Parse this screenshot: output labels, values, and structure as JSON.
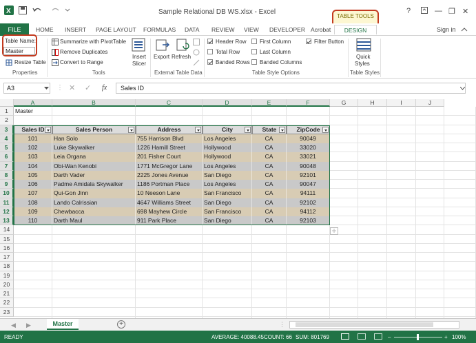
{
  "window": {
    "title": "Sample Relational DB WS.xlsx - Excel",
    "context_group": "TABLE TOOLS",
    "sign_in": "Sign in",
    "help": "?",
    "minimize": "—",
    "restore": "❐",
    "close": "✕"
  },
  "tabs": {
    "file": "FILE",
    "items": [
      "HOME",
      "INSERT",
      "PAGE LAYOUT",
      "FORMULAS",
      "DATA",
      "REVIEW",
      "VIEW",
      "DEVELOPER",
      "Acrobat"
    ],
    "design": "DESIGN"
  },
  "ribbon": {
    "properties": {
      "table_name_label": "Table Name:",
      "table_name_value": "Master",
      "resize": "Resize Table",
      "group": "Properties"
    },
    "tools": {
      "summarize": "Summarize with PivotTable",
      "remove_dup": "Remove Duplicates",
      "convert": "Convert to Range",
      "slicer1": "Insert",
      "slicer2": "Slicer",
      "group": "Tools"
    },
    "external": {
      "export": "Export",
      "refresh": "Refresh",
      "group": "External Table Data"
    },
    "style_options": {
      "header_row": "Header Row",
      "total_row": "Total Row",
      "banded_rows": "Banded Rows",
      "first_col": "First Column",
      "last_col": "Last Column",
      "banded_cols": "Banded Columns",
      "filter_btn": "Filter Button",
      "group": "Table Style Options"
    },
    "styles": {
      "quick1": "Quick",
      "quick2": "Styles",
      "group": "Table Styles"
    }
  },
  "formula_bar": {
    "name_box": "A3",
    "fx": "fx",
    "value": "Sales ID"
  },
  "grid": {
    "columns": [
      "A",
      "B",
      "C",
      "D",
      "E",
      "F",
      "G",
      "H",
      "I",
      "J"
    ],
    "rows": [
      "1",
      "2",
      "3",
      "4",
      "5",
      "6",
      "7",
      "8",
      "9",
      "10",
      "11",
      "12",
      "13",
      "14",
      "15",
      "16",
      "17",
      "18",
      "19",
      "20",
      "21",
      "22",
      "23"
    ],
    "a1": "Master",
    "table": {
      "headers": [
        "Sales ID",
        "Sales Person",
        "Address",
        "City",
        "State",
        "ZipCode"
      ],
      "rows": [
        [
          "101",
          "Han Solo",
          "755 Harrison Blvd",
          "Los Angeles",
          "CA",
          "90049"
        ],
        [
          "102",
          "Luke Skywalker",
          "1226 Hamill Street",
          "Hollywood",
          "CA",
          "33020"
        ],
        [
          "103",
          "Leia Organa",
          "201 Fisher Court",
          "Hollywood",
          "CA",
          "33021"
        ],
        [
          "104",
          "Obi-Wan Kenobi",
          "1771 McGregor Lane",
          "Los Angeles",
          "CA",
          "90048"
        ],
        [
          "105",
          "Darth Vader",
          "2225 Jones Avenue",
          "San Diego",
          "CA",
          "92101"
        ],
        [
          "106",
          "Padme Amidala Skywalker",
          "1186 Portman Place",
          "Los Angeles",
          "CA",
          "90047"
        ],
        [
          "107",
          "Qui-Gon Jinn",
          "10 Neeson Lane",
          "San Francisco",
          "CA",
          "94111"
        ],
        [
          "108",
          "Lando Calrissian",
          "4647 Williams Street",
          "San Diego",
          "CA",
          "92102"
        ],
        [
          "109",
          "Chewbacca",
          "698 Mayhew Circle",
          "San Francisco",
          "CA",
          "94112"
        ],
        [
          "110",
          "Darth Maul",
          "911 Park Place",
          "San Diego",
          "CA",
          "92103"
        ]
      ]
    }
  },
  "sheets": {
    "active": "Master",
    "add": "+"
  },
  "status": {
    "ready": "READY",
    "average": "AVERAGE: 40088.45",
    "count": "COUNT: 66",
    "sum": "SUM: 801769",
    "zoom": "100%"
  },
  "colors": {
    "excel_green": "#217346",
    "highlight_red": "#c33a1f",
    "band_tan": "#d8ccb4",
    "band_gray": "#c9c9c9"
  }
}
